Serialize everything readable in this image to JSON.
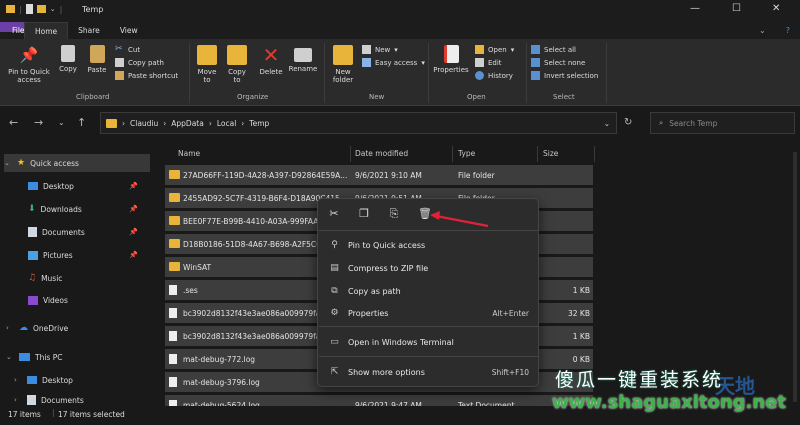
{
  "window": {
    "title": "Temp",
    "minimize": "—",
    "maximize": "☐",
    "close": "✕"
  },
  "tabs": [
    "File",
    "Home",
    "Share",
    "View"
  ],
  "ribbon": {
    "pin_quick_access": "Pin to Quick access",
    "copy": "Copy",
    "paste": "Paste",
    "cut": "Cut",
    "copy_path": "Copy path",
    "paste_shortcut": "Paste shortcut",
    "clipboard_group": "Clipboard",
    "move_to": "Move to",
    "copy_to": "Copy to",
    "delete": "Delete",
    "rename": "Rename",
    "organize_group": "Organize",
    "new_folder": "New folder",
    "new_item": "New",
    "easy_access": "Easy access",
    "new_group": "New",
    "properties": "Properties",
    "open": "Open",
    "edit": "Edit",
    "history": "History",
    "open_group": "Open",
    "select_all": "Select all",
    "select_none": "Select none",
    "invert_selection": "Invert selection",
    "select_group": "Select"
  },
  "address": {
    "crumbs": [
      "Claudiu",
      "AppData",
      "Local",
      "Temp"
    ],
    "search_placeholder": "Search Temp"
  },
  "sidebar": {
    "quick_access": "Quick access",
    "items": [
      "Desktop",
      "Downloads",
      "Documents",
      "Pictures",
      "Music",
      "Videos"
    ],
    "onedrive": "OneDrive",
    "this_pc": "This PC",
    "pc_items": [
      "Desktop",
      "Documents"
    ]
  },
  "columns": {
    "name": "Name",
    "date": "Date modified",
    "type": "Type",
    "size": "Size"
  },
  "files": [
    {
      "name": "27AD66FF-119D-4A28-A397-D92864E59A...",
      "date": "9/6/2021 9:10 AM",
      "type": "File folder",
      "size": "",
      "kind": "folder"
    },
    {
      "name": "2455AD92-5C7F-4319-B6F4-D18A90C415",
      "date": "9/6/2021 9:51 AM",
      "type": "File folder",
      "size": "",
      "kind": "folder"
    },
    {
      "name": "BEE0F77E-B99B-4410-A03A-999FAA...",
      "date": "",
      "type": "",
      "size": "",
      "kind": "folder"
    },
    {
      "name": "D18B0186-51D8-4A67-B698-A2F5C6...",
      "date": "",
      "type": "",
      "size": "",
      "kind": "folder"
    },
    {
      "name": "WinSAT",
      "date": "",
      "type": "",
      "size": "",
      "kind": "folder"
    },
    {
      "name": ".ses",
      "date": "",
      "type": "",
      "size": "1 KB",
      "kind": "file"
    },
    {
      "name": "bc3902d8132f43e3ae086a009979fa8...",
      "date": "",
      "type": "",
      "size": "32 KB",
      "kind": "file"
    },
    {
      "name": "bc3902d8132f43e3ae086a009979fa8...",
      "date": "",
      "type": "",
      "size": "1 KB",
      "kind": "file"
    },
    {
      "name": "mat-debug-772.log",
      "date": "",
      "type": "",
      "size": "0 KB",
      "kind": "file"
    },
    {
      "name": "mat-debug-3796.log",
      "date": "",
      "type": "",
      "size": "",
      "kind": "file"
    },
    {
      "name": "mat-debug-5624.log",
      "date": "9/6/2021 9:47 AM",
      "type": "Text Document",
      "size": "",
      "kind": "file"
    }
  ],
  "status": {
    "count": "17 items",
    "selected": "17 items selected"
  },
  "context_menu": {
    "items": [
      {
        "label": "Pin to Quick access",
        "shortcut": "",
        "icon": "pin-icon"
      },
      {
        "label": "Compress to ZIP file",
        "shortcut": "",
        "icon": "zip-icon"
      },
      {
        "label": "Copy as path",
        "shortcut": "",
        "icon": "copy-path-icon"
      },
      {
        "label": "Properties",
        "shortcut": "Alt+Enter",
        "icon": "properties-icon"
      },
      {
        "label": "Open in Windows Terminal",
        "shortcut": "",
        "icon": "terminal-icon"
      },
      {
        "label": "Show more options",
        "shortcut": "Shift+F10",
        "icon": "more-options-icon"
      }
    ]
  },
  "watermark": {
    "text": "傻瓜一键重装系统",
    "url": "www.shaguaxitong.net"
  },
  "colors": {
    "accent": "#6c3fa7",
    "folder": "#e8b43a",
    "arrow": "#e0213a"
  }
}
